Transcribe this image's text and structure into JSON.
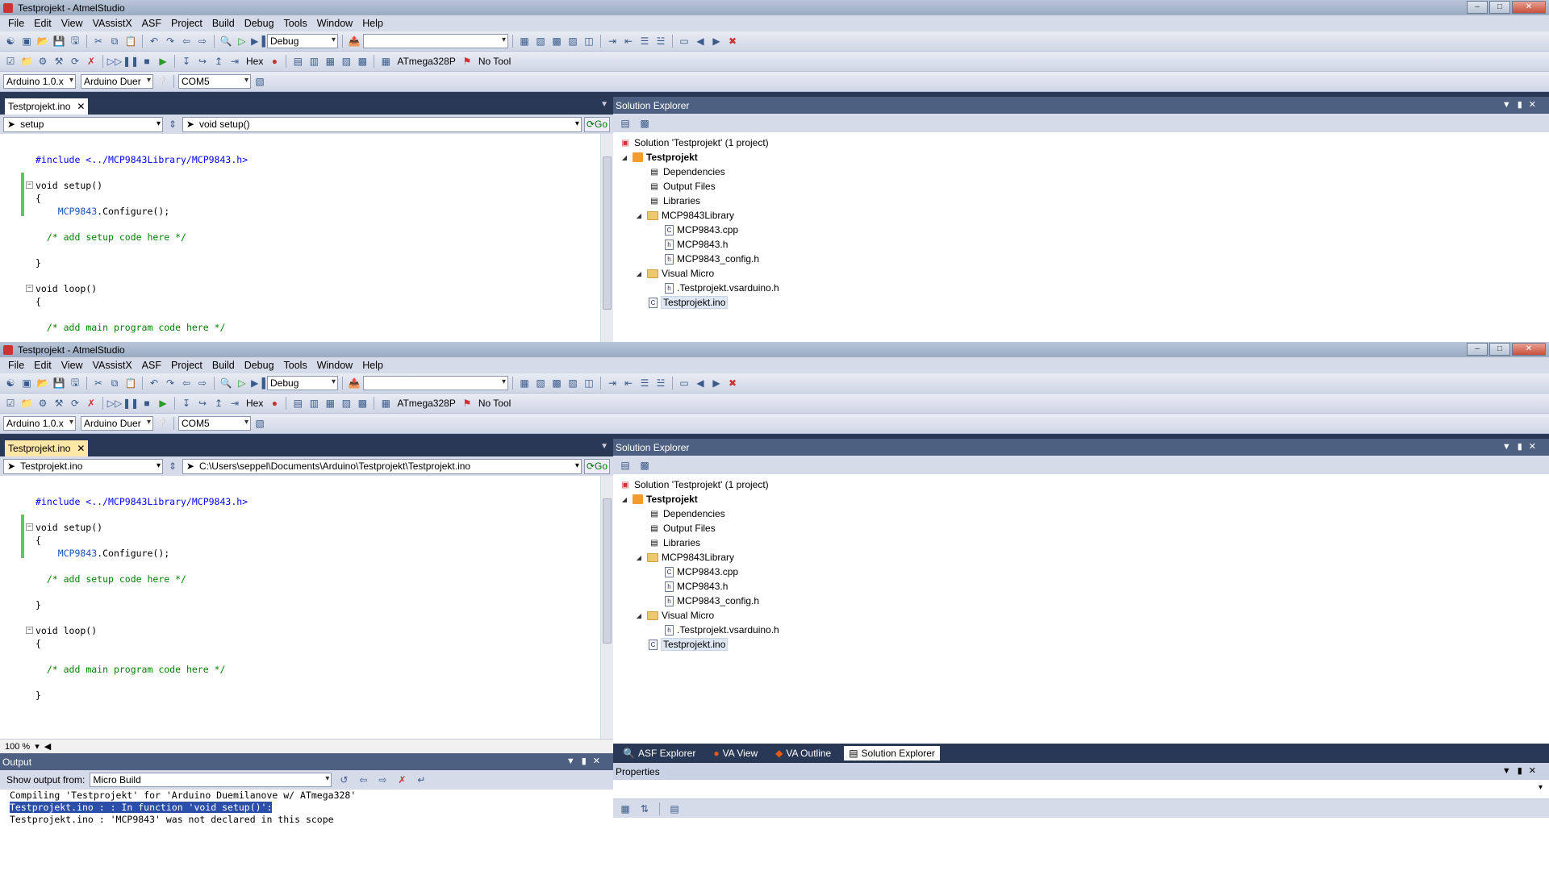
{
  "window_title": "Testprojekt - AtmelStudio",
  "window_buttons": [
    "–",
    "□",
    "✕"
  ],
  "menu": [
    "File",
    "Edit",
    "View",
    "VAssistX",
    "ASF",
    "Project",
    "Build",
    "Debug",
    "Tools",
    "Window",
    "Help"
  ],
  "toolbar": {
    "config": "Debug",
    "search_value": "",
    "hex_label": "Hex",
    "device": "ATmega328P",
    "tool": "No Tool",
    "arduino_version": "Arduino 1.0.x",
    "board": "Arduino Duer",
    "port": "COM5"
  },
  "editor": {
    "tab_label": "Testprojekt.ino",
    "tab_close": "✕",
    "go_label": "Go",
    "w1_scope": "setup",
    "w1_member": "void setup()",
    "w2_scope": "Testprojekt.ino",
    "w2_member": "C:\\Users\\seppel\\Documents\\Arduino\\Testprojekt\\Testprojekt.ino",
    "zoom": "100 %",
    "code": {
      "include": "#include <../MCP9843Library/MCP9843.h>",
      "setup_sig": "void setup()",
      "open_brace": "{",
      "call_obj": "MCP9843",
      "call_rest": ".Configure();",
      "setup_comment": "/* add setup code here */",
      "close_brace": "}",
      "loop_sig": "void loop()",
      "loop_comment": "/* add main program code here */"
    }
  },
  "solution_explorer": {
    "title": "Solution Explorer",
    "solution": "Solution 'Testprojekt' (1 project)",
    "project": "Testprojekt",
    "dependencies": "Dependencies",
    "output_files": "Output Files",
    "libraries": "Libraries",
    "lib_folder": "MCP9843Library",
    "lib_cpp": "MCP9843.cpp",
    "lib_h": "MCP9843.h",
    "lib_config": "MCP9843_config.h",
    "vm_folder": "Visual Micro",
    "vm_file": ".Testprojekt.vsarduino.h",
    "ino_file": "Testprojekt.ino"
  },
  "bottom_tabs": [
    "ASF Explorer",
    "VA View",
    "VA Outline",
    "Solution Explorer"
  ],
  "properties": {
    "title": "Properties"
  },
  "output": {
    "title": "Output",
    "show_from_label": "Show output from:",
    "source": "Micro Build",
    "lines": [
      "Compiling 'Testprojekt' for 'Arduino Duemilanove w/ ATmega328'",
      "Testprojekt.ino : : In function 'void setup()':",
      "Testprojekt.ino : 'MCP9843' was not declared in this scope"
    ]
  },
  "colors": {
    "chrome": "#293955",
    "keyword": "#0000ff",
    "comment": "#008000",
    "change_bar": "#5ac85a"
  }
}
